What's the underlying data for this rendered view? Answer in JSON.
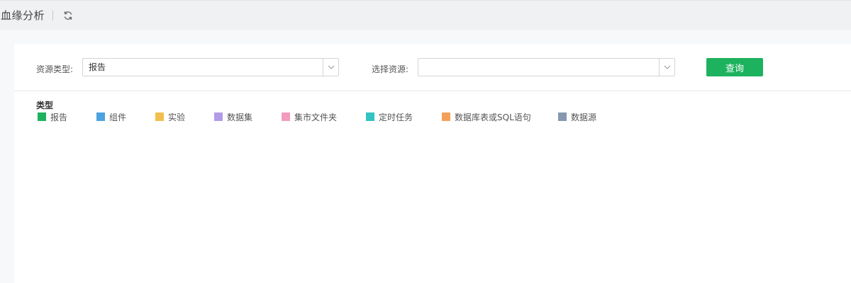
{
  "header": {
    "title": "血缘分析",
    "refresh_icon": "refresh-icon"
  },
  "filters": {
    "resource_type": {
      "label": "资源类型:",
      "value": "报告"
    },
    "resource": {
      "label": "选择资源:",
      "value": ""
    },
    "query_label": "查询",
    "accent_color": "#1db25e"
  },
  "legend": {
    "title": "类型",
    "items": [
      {
        "label": "报告",
        "color": "#1db25e"
      },
      {
        "label": "组件",
        "color": "#4da3e0"
      },
      {
        "label": "实验",
        "color": "#f0c04d"
      },
      {
        "label": "数据集",
        "color": "#b39be8"
      },
      {
        "label": "集市文件夹",
        "color": "#f39bbd"
      },
      {
        "label": "定时任务",
        "color": "#33c3c3"
      },
      {
        "label": "数据库表或SQL语句",
        "color": "#f5a05a"
      },
      {
        "label": "数据源",
        "color": "#8797b2"
      }
    ]
  }
}
